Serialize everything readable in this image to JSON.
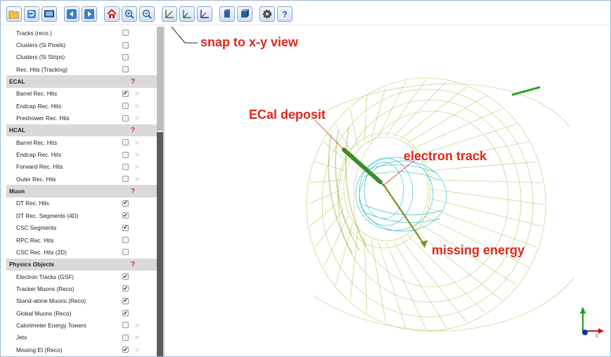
{
  "toolbar": {
    "buttons": [
      {
        "name": "open-folder",
        "icon": "folder-icon"
      },
      {
        "name": "reload",
        "icon": "reload-icon"
      },
      {
        "name": "screen",
        "icon": "monitor-icon"
      },
      {
        "name": "previous",
        "icon": "arrow-left-icon"
      },
      {
        "name": "next",
        "icon": "arrow-right-icon"
      },
      {
        "name": "home-view",
        "icon": "home-icon"
      },
      {
        "name": "zoom-in",
        "icon": "zoom-in-icon"
      },
      {
        "name": "zoom-out",
        "icon": "zoom-out-icon"
      },
      {
        "name": "snap-xy-view",
        "icon": "axes-xy-icon"
      },
      {
        "name": "snap-yz-view",
        "icon": "axes-yz-icon"
      },
      {
        "name": "snap-xz-view",
        "icon": "axes-xz-icon"
      },
      {
        "name": "perspective-view",
        "icon": "cube-perspective-icon"
      },
      {
        "name": "orthographic-view",
        "icon": "cube-ortho-icon"
      },
      {
        "name": "settings",
        "icon": "gear-icon"
      },
      {
        "name": "help",
        "icon": "help-icon"
      }
    ]
  },
  "sidebar": {
    "rows": [
      {
        "label": "Tracks (reco.)",
        "type": "item",
        "checked": false,
        "arrow": false
      },
      {
        "label": "Clusters (Si Pixels)",
        "type": "item",
        "checked": false,
        "arrow": false
      },
      {
        "label": "Clusters (Si Strips)",
        "type": "item",
        "checked": false,
        "arrow": false
      },
      {
        "label": "Rec. Hits (Tracking)",
        "type": "item",
        "checked": false,
        "arrow": false
      },
      {
        "label": "ECAL",
        "type": "group",
        "help": "?"
      },
      {
        "label": "Barrel Rec. Hits",
        "type": "item",
        "checked": true,
        "arrow": true
      },
      {
        "label": "Endcap Rec. Hits",
        "type": "item",
        "checked": false,
        "arrow": true
      },
      {
        "label": "Preshower Rec. Hits",
        "type": "item",
        "checked": false,
        "arrow": true
      },
      {
        "label": "HCAL",
        "type": "group",
        "help": "?"
      },
      {
        "label": "Barrel Rec. Hits",
        "type": "item",
        "checked": false,
        "arrow": true
      },
      {
        "label": "Endcap Rec. Hits",
        "type": "item",
        "checked": false,
        "arrow": true
      },
      {
        "label": "Forward Rec. Hits",
        "type": "item",
        "checked": false,
        "arrow": true
      },
      {
        "label": "Outer Rec. Hits",
        "type": "item",
        "checked": false,
        "arrow": true
      },
      {
        "label": "Muon",
        "type": "group",
        "help": "?"
      },
      {
        "label": "DT Rec. Hits",
        "type": "item",
        "checked": true,
        "arrow": false
      },
      {
        "label": "DT Rec. Segments (4D)",
        "type": "item",
        "checked": true,
        "arrow": false
      },
      {
        "label": "CSC Segments",
        "type": "item",
        "checked": true,
        "arrow": false
      },
      {
        "label": "RPC Rec. Hits",
        "type": "item",
        "checked": false,
        "arrow": false
      },
      {
        "label": "CSC Rec. Hits (2D)",
        "type": "item",
        "checked": false,
        "arrow": false
      },
      {
        "label": "Physics Objects",
        "type": "group",
        "help": "?"
      },
      {
        "label": "Electron Tracks (GSF)",
        "type": "item",
        "checked": true,
        "arrow": false
      },
      {
        "label": "Tracker Muons (Reco)",
        "type": "item",
        "checked": true,
        "arrow": false
      },
      {
        "label": "Stand-alone Muons (Reco)",
        "type": "item",
        "checked": true,
        "arrow": false
      },
      {
        "label": "Global Muons (Reco)",
        "type": "item",
        "checked": true,
        "arrow": false
      },
      {
        "label": "Calorimeter Energy Towers",
        "type": "item",
        "checked": false,
        "arrow": true
      },
      {
        "label": "Jets",
        "type": "item",
        "checked": false,
        "arrow": true
      },
      {
        "label": "Missing Et (Reco)",
        "type": "item",
        "checked": true,
        "arrow": true
      }
    ]
  },
  "annotations": {
    "snap": "snap to x-y view",
    "ecal": "ECal deposit",
    "electron": "electron track",
    "missing": "missing energy"
  },
  "axes": {
    "y": "y",
    "x": "x"
  },
  "colors": {
    "annotation": "#e0261d",
    "ecal_barrel": "#9dbf3c",
    "tracker": "#3fc3c9",
    "electron_track": "#2e8b2e",
    "met_arrow": "#8a8a1a",
    "axis_x": "#c0181a",
    "axis_y": "#1a9a1a",
    "axis_z": "#1a2fb0"
  }
}
